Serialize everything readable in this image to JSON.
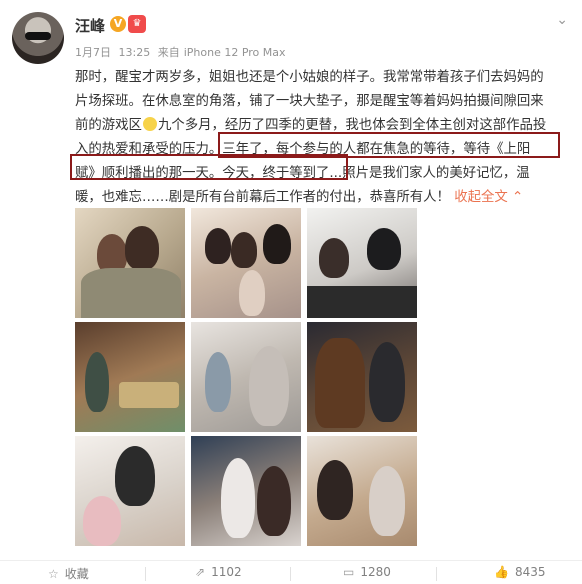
{
  "post": {
    "author": "汪峰",
    "verified_badge": "V",
    "vip_badge": "♛",
    "date": "1月7日",
    "time": "13:25",
    "source_prefix": "来自",
    "source": "iPhone 12 Pro Max",
    "lines": [
      "那时，醒宝才两岁多，姐姐也还是个小姑娘的样子。我常常带着孩子们去妈妈的",
      "片场探班。在休息室的角落，铺了一块大垫子，那是醒宝等着妈妈拍摄间隙回来",
      "前的游戏区",
      "九个多月，经历了四季的更替，我也体会到全体主创对这部作品投",
      "入的热爱和承受的压力。三年了，每个参与的人都在焦急的等待，等待《上阳",
      "赋》顺利播出的那一天。今天，终于等到了...照片是我们家人的美好记忆，温",
      "暖，也难忘……剧是所有台前幕后工作者的付出，恭喜所有人！"
    ],
    "collapse_label": "收起全文",
    "collapse_icon": "chevron-up-icon",
    "emoji": "smile-emoji"
  },
  "photos": [
    {
      "name": "photo-1"
    },
    {
      "name": "photo-2"
    },
    {
      "name": "photo-3"
    },
    {
      "name": "photo-4"
    },
    {
      "name": "photo-5"
    },
    {
      "name": "photo-6"
    },
    {
      "name": "photo-7"
    },
    {
      "name": "photo-8"
    },
    {
      "name": "photo-9"
    }
  ],
  "footer": {
    "favorite_label": "收藏",
    "repost_count": "1102",
    "comment_count": "1280",
    "like_count": "8435"
  },
  "colors": {
    "accent": "#eb7350",
    "highlight_box": "#8b1a1a",
    "verified": "#f5a623"
  }
}
